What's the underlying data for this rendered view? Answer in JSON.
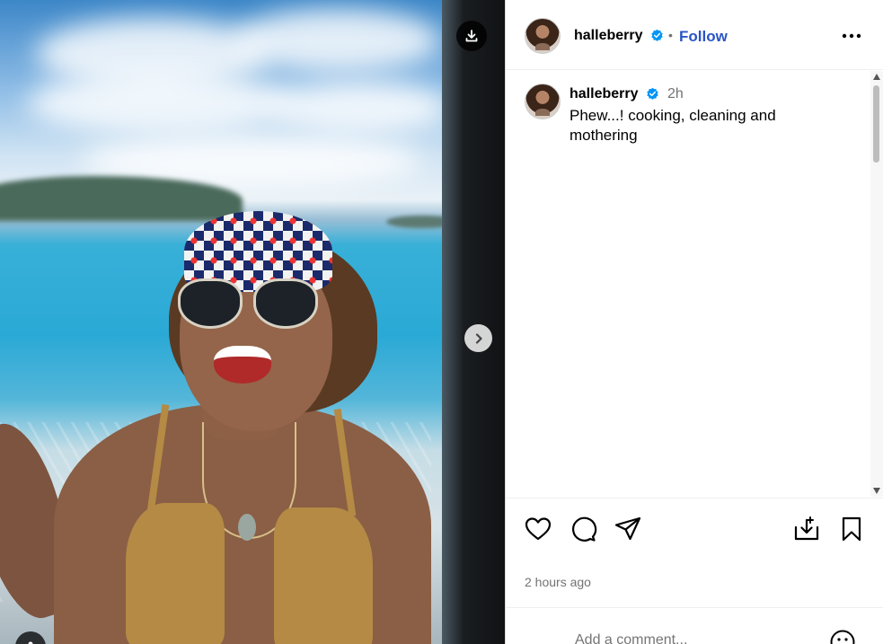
{
  "post": {
    "author": "halleberry",
    "verified_icon": "verified-badge-icon",
    "follow_label": "Follow",
    "separator": "•",
    "caption": "Phew...! cooking, cleaning and mothering",
    "caption_age": "2h",
    "timestamp": "2 hours ago"
  },
  "media": {
    "download_icon": "download-icon",
    "next_icon": "chevron-right-icon"
  },
  "actions": [
    "heart-icon",
    "comment-icon",
    "share-icon",
    "save-to-collection-icon",
    "bookmark-icon"
  ],
  "comment": {
    "placeholder": "Add a comment..."
  },
  "colors": {
    "follow_blue": "#2a55c4",
    "verified_blue": "#0095f6",
    "muted_text": "#737373"
  }
}
